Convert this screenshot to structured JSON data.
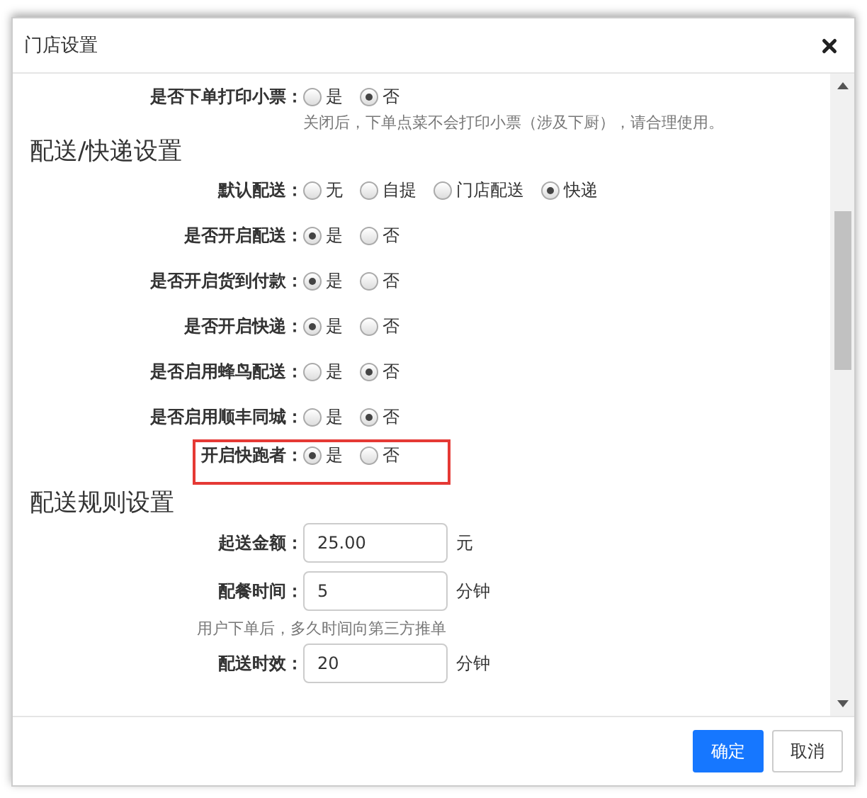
{
  "window": {
    "title": "门店设置"
  },
  "sections": [
    {
      "rows": [
        {
          "kind": "radio",
          "label": "是否下单打印小票：",
          "options": [
            {
              "label": "是",
              "selected": false
            },
            {
              "label": "否",
              "selected": true
            }
          ],
          "hint": "关闭后，下单点菜不会打印小票（涉及下厨），请合理使用。"
        }
      ]
    },
    {
      "heading": "配送/快递设置",
      "rows": [
        {
          "kind": "radio",
          "label": "默认配送：",
          "options": [
            {
              "label": "无",
              "selected": false
            },
            {
              "label": "自提",
              "selected": false
            },
            {
              "label": "门店配送",
              "selected": false
            },
            {
              "label": "快递",
              "selected": true
            }
          ]
        },
        {
          "kind": "radio",
          "label": "是否开启配送：",
          "options": [
            {
              "label": "是",
              "selected": true
            },
            {
              "label": "否",
              "selected": false
            }
          ]
        },
        {
          "kind": "radio",
          "label": "是否开启货到付款：",
          "options": [
            {
              "label": "是",
              "selected": true
            },
            {
              "label": "否",
              "selected": false
            }
          ]
        },
        {
          "kind": "radio",
          "label": "是否开启快递：",
          "options": [
            {
              "label": "是",
              "selected": true
            },
            {
              "label": "否",
              "selected": false
            }
          ]
        },
        {
          "kind": "radio",
          "label": "是否启用蜂鸟配送：",
          "options": [
            {
              "label": "是",
              "selected": false
            },
            {
              "label": "否",
              "selected": true
            }
          ]
        },
        {
          "kind": "radio",
          "label": "是否启用顺丰同城：",
          "options": [
            {
              "label": "是",
              "selected": false
            },
            {
              "label": "否",
              "selected": true
            }
          ]
        },
        {
          "kind": "radio",
          "label": "开启快跑者：",
          "highlighted": true,
          "options": [
            {
              "label": "是",
              "selected": true
            },
            {
              "label": "否",
              "selected": false
            }
          ]
        }
      ]
    },
    {
      "heading": "配送规则设置",
      "rows": [
        {
          "kind": "input",
          "label": "起送金额：",
          "value": "25.00",
          "unit": "元"
        },
        {
          "kind": "input",
          "label": "配餐时间：",
          "value": "5",
          "unit": "分钟"
        },
        {
          "kind": "note",
          "text": "用户下单后，多久时间向第三方推单"
        },
        {
          "kind": "input",
          "label": "配送时效：",
          "value": "20",
          "unit": "分钟"
        }
      ]
    }
  ],
  "buttons": [
    {
      "label": "确定",
      "kind": "primary"
    },
    {
      "label": "取消",
      "kind": "default"
    }
  ]
}
